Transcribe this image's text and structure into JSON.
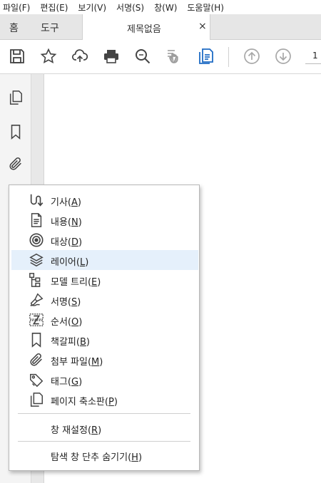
{
  "menubar": {
    "items": [
      "파일(F)",
      "편집(E)",
      "보기(V)",
      "서명(S)",
      "창(W)",
      "도움말(H)"
    ]
  },
  "tabs": {
    "home": "홈",
    "tools": "도구",
    "document": "제목없음",
    "close": "×"
  },
  "toolbar": {
    "icons": [
      "save-icon",
      "star-icon",
      "cloud-upload-icon",
      "print-icon",
      "search-icon",
      "hand-tool-icon",
      "page-view-icon",
      "previous-page-icon",
      "next-page-icon"
    ],
    "page_number": "1"
  },
  "leftnav": {
    "icons": [
      "pages-icon",
      "bookmark-icon",
      "attachment-icon"
    ]
  },
  "context_menu": {
    "items": [
      {
        "label": "기사(",
        "key": "A",
        "suffix": ")",
        "icon": "articles-icon"
      },
      {
        "label": "내용(",
        "key": "N",
        "suffix": ")",
        "icon": "content-icon"
      },
      {
        "label": "대상(",
        "key": "D",
        "suffix": ")",
        "icon": "destinations-icon"
      },
      {
        "label": "레이어(",
        "key": "L",
        "suffix": ")",
        "icon": "layers-icon"
      },
      {
        "label": "모델 트리(",
        "key": "E",
        "suffix": ")",
        "icon": "model-tree-icon"
      },
      {
        "label": "서명(",
        "key": "S",
        "suffix": ")",
        "icon": "signature-icon"
      },
      {
        "label": "순서(",
        "key": "O",
        "suffix": ")",
        "icon": "order-icon"
      },
      {
        "label": "책갈피(",
        "key": "B",
        "suffix": ")",
        "icon": "bookmark-icon"
      },
      {
        "label": "첨부 파일(",
        "key": "M",
        "suffix": ")",
        "icon": "attachment-icon"
      },
      {
        "label": "태그(",
        "key": "G",
        "suffix": ")",
        "icon": "tag-icon"
      },
      {
        "label": "페이지 축소판(",
        "key": "P",
        "suffix": ")",
        "icon": "page-thumbnails-icon"
      }
    ],
    "highlighted_index": 3,
    "reset": {
      "label": "창 재설정(",
      "key": "R",
      "suffix": ")"
    },
    "hide": {
      "label": "탐색 창 단추 숨기기(",
      "key": "H",
      "suffix": ")"
    }
  }
}
